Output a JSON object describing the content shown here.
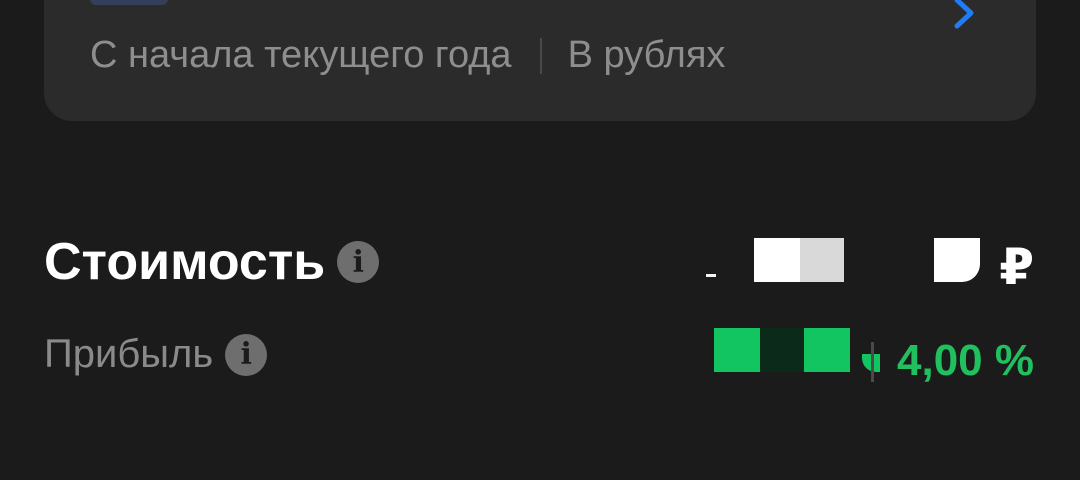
{
  "card": {
    "period_label": "С начала текущего года",
    "currency_label": "В рублях",
    "chevron_icon": "chevron-right-icon",
    "accent_color": "#1f7cf5"
  },
  "portfolio": {
    "value_title": "Стоимость",
    "value_currency": "₽",
    "profit_title": "Прибыль",
    "profit_percent": "4,00 %",
    "profit_color": "#21c05f",
    "info_icon": "info-icon",
    "info_glyph": "i"
  }
}
